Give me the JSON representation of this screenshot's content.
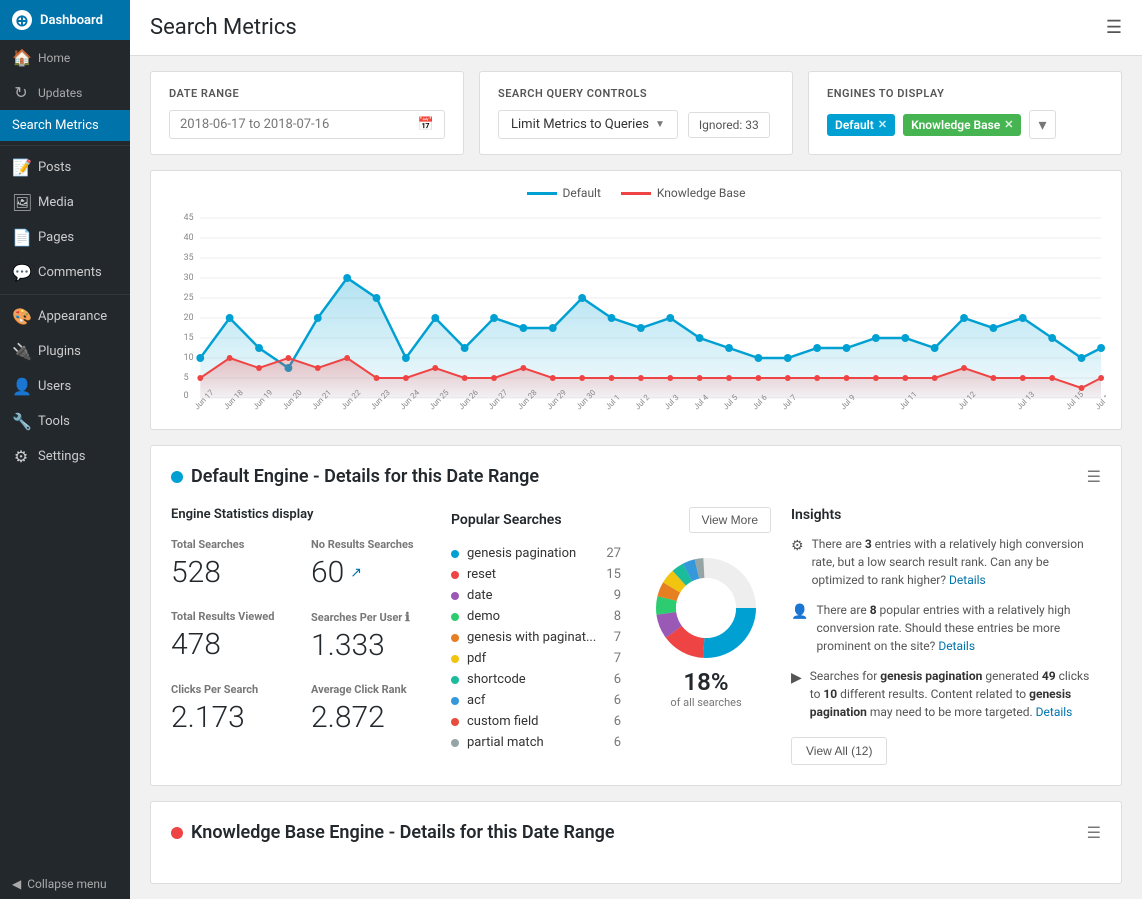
{
  "sidebar": {
    "logo_text": "Dashboard",
    "items": [
      {
        "id": "home",
        "label": "Home",
        "icon": "🏠",
        "active": false
      },
      {
        "id": "updates",
        "label": "Updates",
        "icon": "↻",
        "active": false
      },
      {
        "id": "search-metrics",
        "label": "Search Metrics",
        "icon": "",
        "active": true
      },
      {
        "id": "posts",
        "label": "Posts",
        "icon": "📝",
        "active": false
      },
      {
        "id": "media",
        "label": "Media",
        "icon": "🖼",
        "active": false
      },
      {
        "id": "pages",
        "label": "Pages",
        "icon": "📄",
        "active": false
      },
      {
        "id": "comments",
        "label": "Comments",
        "icon": "💬",
        "active": false
      },
      {
        "id": "appearance",
        "label": "Appearance",
        "icon": "🎨",
        "active": false
      },
      {
        "id": "plugins",
        "label": "Plugins",
        "icon": "🔌",
        "active": false
      },
      {
        "id": "users",
        "label": "Users",
        "icon": "👤",
        "active": false
      },
      {
        "id": "tools",
        "label": "Tools",
        "icon": "🔧",
        "active": false
      },
      {
        "id": "settings",
        "label": "Settings",
        "icon": "⚙",
        "active": false
      }
    ],
    "collapse_label": "Collapse menu"
  },
  "header": {
    "title": "Search Metrics"
  },
  "date_range": {
    "label": "Date Range",
    "value": "2018-06-17 to 2018-07-16"
  },
  "query_controls": {
    "label": "Search Query Controls",
    "dropdown_label": "Limit Metrics to Queries",
    "ignored_label": "Ignored: 33"
  },
  "engines": {
    "label": "Engines to display",
    "tags": [
      {
        "name": "Default",
        "type": "default"
      },
      {
        "name": "Knowledge Base",
        "type": "knowledge"
      }
    ]
  },
  "chart": {
    "legend": [
      {
        "label": "Default",
        "color": "#00a0d2"
      },
      {
        "label": "Knowledge Base",
        "color": "#e44"
      }
    ]
  },
  "default_engine": {
    "section_title": "Default Engine - Details for this Date Range",
    "stats_title": "Engine Statistics display",
    "stats": [
      {
        "label": "Total Searches",
        "value": "528",
        "has_link": false
      },
      {
        "label": "No Results Searches",
        "value": "60",
        "has_link": true
      },
      {
        "label": "Total Results Viewed",
        "value": "478",
        "has_link": false
      },
      {
        "label": "Searches Per User",
        "value": "1.333",
        "has_info": true
      },
      {
        "label": "Clicks Per Search",
        "value": "2.173",
        "has_link": false
      },
      {
        "label": "Average Click Rank",
        "value": "2.872",
        "has_link": false
      }
    ],
    "popular_searches_title": "Popular Searches",
    "view_more_label": "View More",
    "popular_items": [
      {
        "name": "genesis pagination",
        "count": 27,
        "color": "#00a0d2"
      },
      {
        "name": "reset",
        "count": 15,
        "color": "#e44"
      },
      {
        "name": "date",
        "count": 9,
        "color": "#9b59b6"
      },
      {
        "name": "demo",
        "count": 8,
        "color": "#2ecc71"
      },
      {
        "name": "genesis with paginat...",
        "count": 7,
        "color": "#e67e22"
      },
      {
        "name": "pdf",
        "count": 7,
        "color": "#f1c40f"
      },
      {
        "name": "shortcode",
        "count": 6,
        "color": "#1abc9c"
      },
      {
        "name": "acf",
        "count": 6,
        "color": "#3498db"
      },
      {
        "name": "custom field",
        "count": 6,
        "color": "#e74c3c"
      },
      {
        "name": "partial match",
        "count": 6,
        "color": "#95a5a6"
      }
    ],
    "donut_percent": "18%",
    "donut_label": "of all searches",
    "insights_title": "Insights",
    "insights": [
      {
        "icon": "⚙",
        "text": "There are <strong>3</strong> entries with a relatively high conversion rate, but a low search result rank. Can any be optimized to rank higher? <a href='#'>Details</a>"
      },
      {
        "icon": "👤",
        "text": "There are <strong>8</strong> popular entries with a relatively high conversion rate. Should these entries be more prominent on the site? <a href='#'>Details</a>"
      },
      {
        "icon": "▶",
        "text": "Searches for <strong>genesis pagination</strong> generated <strong>49</strong> clicks to <strong>10</strong> different results. Content related to <strong>genesis pagination</strong> may need to be more targeted. <a href='#'>Details</a>"
      }
    ],
    "view_all_label": "View All (12)"
  },
  "kb_section": {
    "section_title": "Knowledge Base Engine - Details for this Date Range"
  }
}
